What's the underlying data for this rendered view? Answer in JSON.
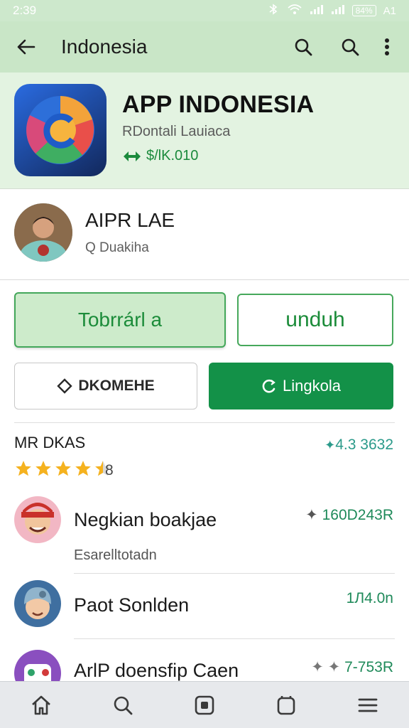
{
  "status_bar": {
    "time": "2:39",
    "signal_text": "A1",
    "battery_text": "84%"
  },
  "app_bar": {
    "title": "Indonesia"
  },
  "app": {
    "title": "APP INDONESIA",
    "subtitle": "RDontali Lauiaca",
    "price": "$/lK.010"
  },
  "developer": {
    "name": "AIPR LAE",
    "subtitle": "Q Duakiha"
  },
  "buttons": {
    "primary_light": "Tobrrárl a",
    "download": "unduh",
    "secondary": "DKOMEHE",
    "action": "Lingkola"
  },
  "ratings": {
    "label": "MR DKAS",
    "value": "4.3 3632",
    "stars": 4,
    "count": "8"
  },
  "list": [
    {
      "title": "Negkian boakjae",
      "subtitle": "Esarelltotadn",
      "value": "160D243R"
    },
    {
      "title": "Paot Sonlden",
      "subtitle": "",
      "value": "1Л4.0n"
    },
    {
      "title": "ArlP doensfip Caen",
      "subtitle": "",
      "value": "7-753R"
    }
  ],
  "colors": {
    "primary": "#139148",
    "appbar": "#c9e6c7",
    "header": "#e3f3e1"
  }
}
